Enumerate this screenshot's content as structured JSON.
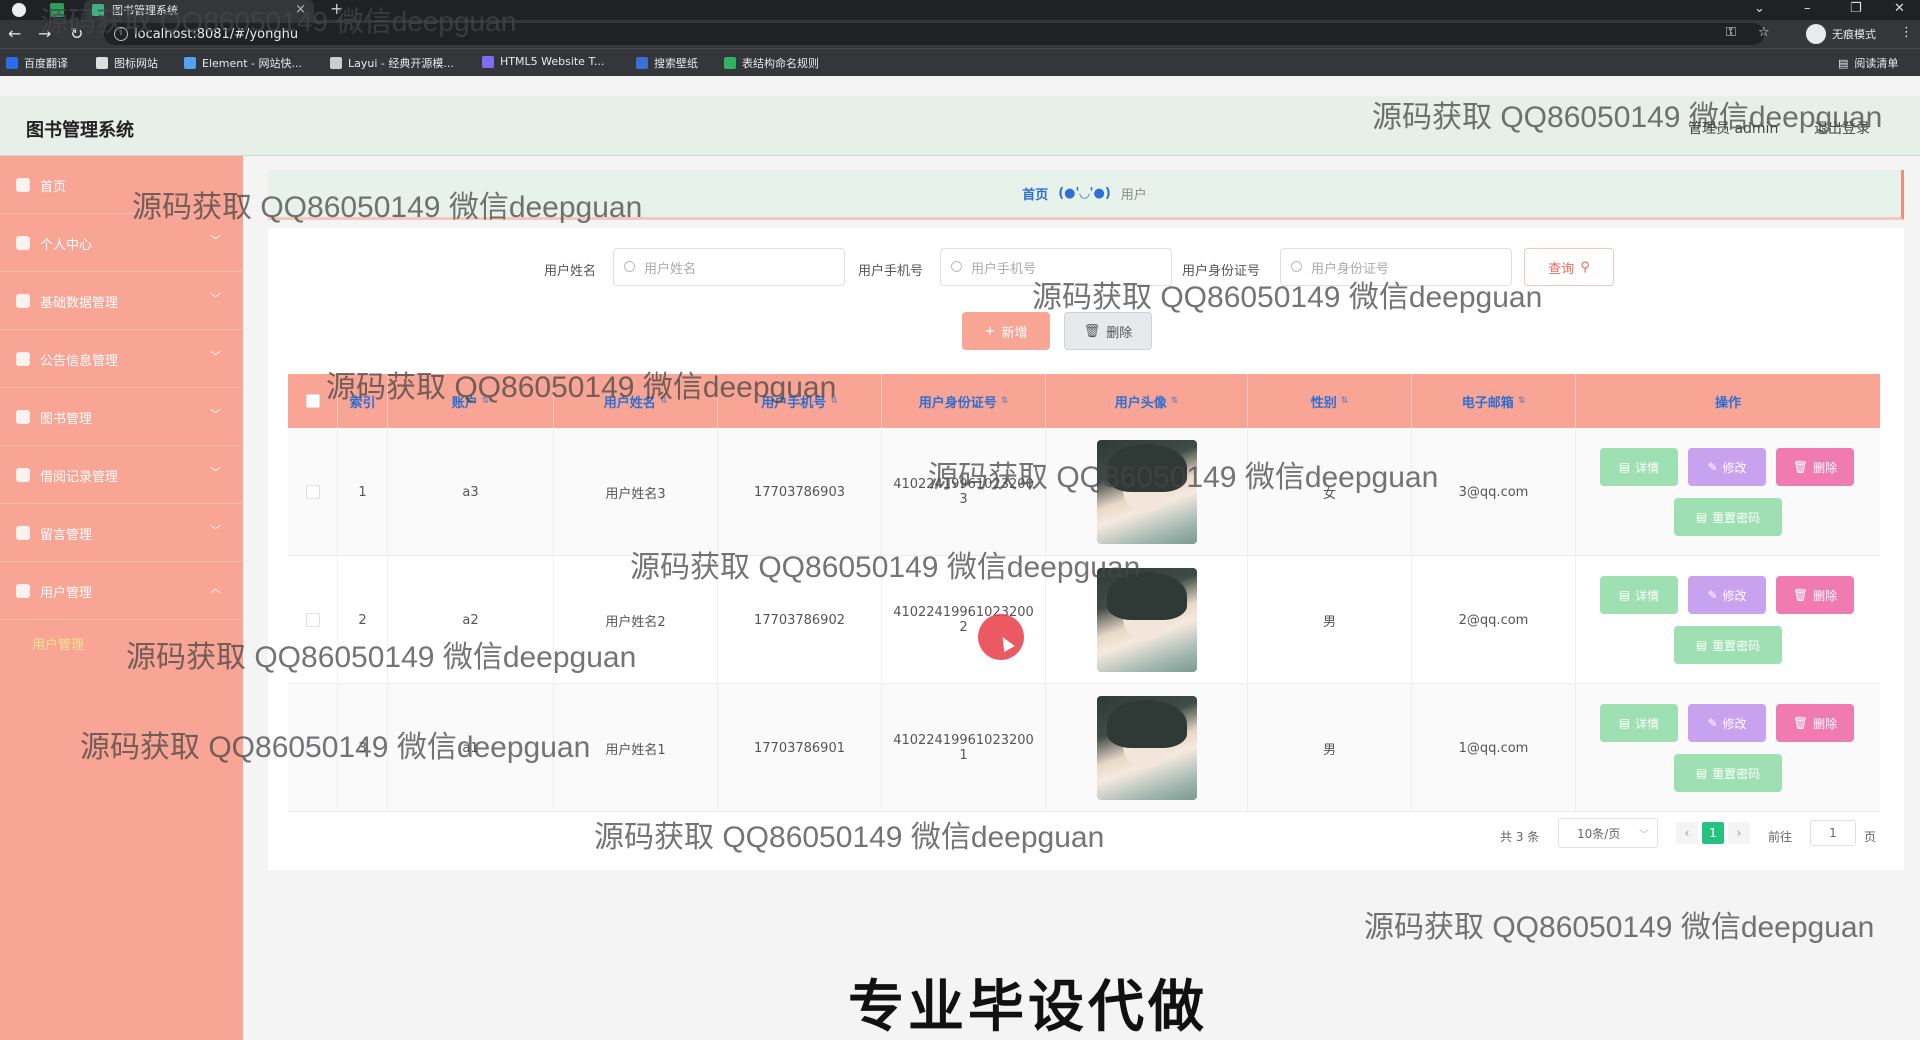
{
  "browser": {
    "tab_title": "图书管理系统",
    "url": "localhost:8081/#/yonghu",
    "incognito_label": "无痕模式",
    "reading_list": "阅读清单",
    "bookmarks": [
      {
        "label": "百度翻译",
        "color": "#2b6de8"
      },
      {
        "label": "图标网站",
        "color": "#dddddd"
      },
      {
        "label": "Element - 网站快...",
        "color": "#4fa3f5"
      },
      {
        "label": "Layui - 经典开源模...",
        "color": "#cccccc"
      },
      {
        "label": "HTML5 Website T...",
        "color": "#7e6cf2"
      },
      {
        "label": "搜索壁纸",
        "color": "#3b6fd6"
      },
      {
        "label": "表结构命名规则",
        "color": "#2fb362"
      }
    ]
  },
  "app": {
    "title": "图书管理系统",
    "admin_label": "管理员 admin",
    "logout": "退出登录"
  },
  "sidebar": {
    "items": [
      {
        "label": "首页"
      },
      {
        "label": "个人中心"
      },
      {
        "label": "基础数据管理"
      },
      {
        "label": "公告信息管理"
      },
      {
        "label": "图书管理"
      },
      {
        "label": "借阅记录管理"
      },
      {
        "label": "留言管理"
      },
      {
        "label": "用户管理"
      }
    ],
    "active_sub": "用户管理"
  },
  "breadcrumb": {
    "home": "首页",
    "sep": "(●'◡'●)",
    "current": "用户"
  },
  "search": {
    "name_label": "用户姓名",
    "name_placeholder": "用户姓名",
    "phone_label": "用户手机号",
    "phone_placeholder": "用户手机号",
    "id_label": "用户身份证号",
    "id_placeholder": "用户身份证号",
    "query_button": "查询"
  },
  "toolbar": {
    "add": "新增",
    "delete": "删除"
  },
  "table": {
    "headers": [
      "索引",
      "账户",
      "用户姓名",
      "用户手机号",
      "用户身份证号",
      "用户头像",
      "性别",
      "电子邮箱",
      "操作"
    ],
    "rows": [
      {
        "index": "1",
        "account": "a3",
        "name": "用户姓名3",
        "phone": "17703786903",
        "id_line1": "41022419961023200",
        "id_line2": "3",
        "gender": "女",
        "email": "3@qq.com"
      },
      {
        "index": "2",
        "account": "a2",
        "name": "用户姓名2",
        "phone": "17703786902",
        "id_line1": "41022419961023200",
        "id_line2": "2",
        "gender": "男",
        "email": "2@qq.com"
      },
      {
        "index": "3",
        "account": "a1",
        "name": "用户姓名1",
        "phone": "17703786901",
        "id_line1": "41022419961023200",
        "id_line2": "1",
        "gender": "男",
        "email": "1@qq.com"
      }
    ],
    "actions": {
      "detail": "详情",
      "edit": "修改",
      "delete": "删除",
      "reset": "重置密码"
    }
  },
  "pagination": {
    "total": "共 3 条",
    "page_size": "10条/页",
    "current_page": "1",
    "goto_label": "前往",
    "goto_value": "1",
    "page_suffix": "页"
  },
  "overlay": {
    "watermark": "源码获取 QQ86050149 微信deepguan",
    "banner": "专业毕设代做"
  }
}
